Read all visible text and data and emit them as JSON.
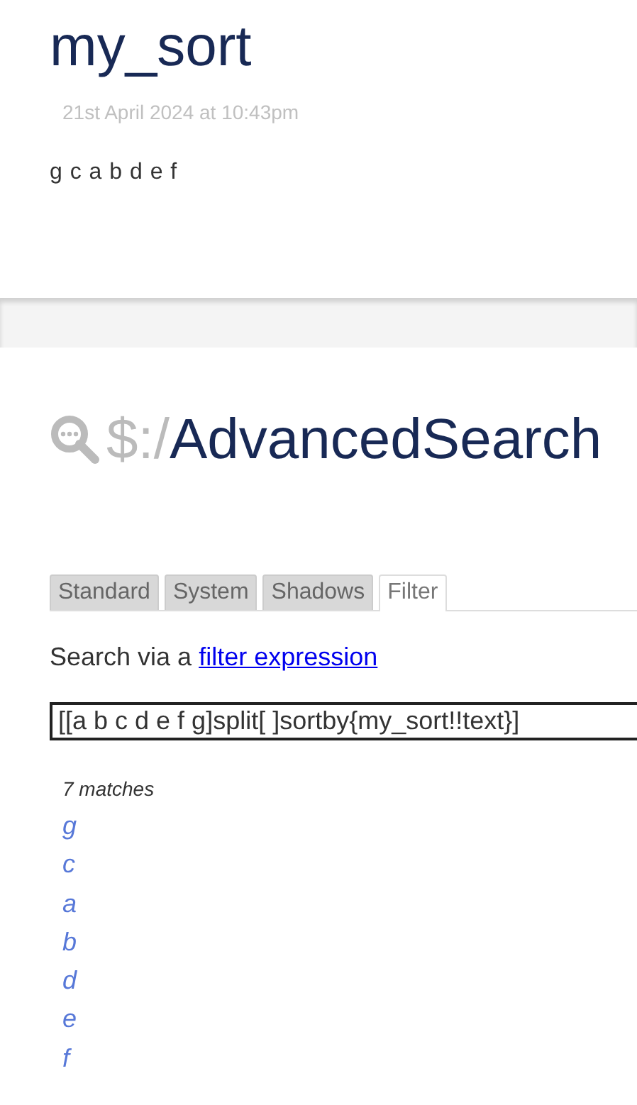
{
  "tiddler": {
    "title": "my_sort",
    "subtitle": "21st April 2024 at 10:43pm",
    "body": "g c a b d e f"
  },
  "search_tiddler": {
    "title_prefix": "$:/",
    "title": "AdvancedSearch",
    "tabs": [
      {
        "label": "Standard",
        "selected": false
      },
      {
        "label": "System",
        "selected": false
      },
      {
        "label": "Shadows",
        "selected": false
      },
      {
        "label": "Filter",
        "selected": true
      }
    ],
    "intro": "Search via a",
    "intro_link": "filter expression",
    "filter": {
      "value": "[[a b c d e f g]split[ ]sortby{my_sort!!text}]"
    },
    "match_count": "7 matches",
    "matches": [
      "g",
      "c",
      "a",
      "b",
      "d",
      "e",
      "f"
    ]
  }
}
